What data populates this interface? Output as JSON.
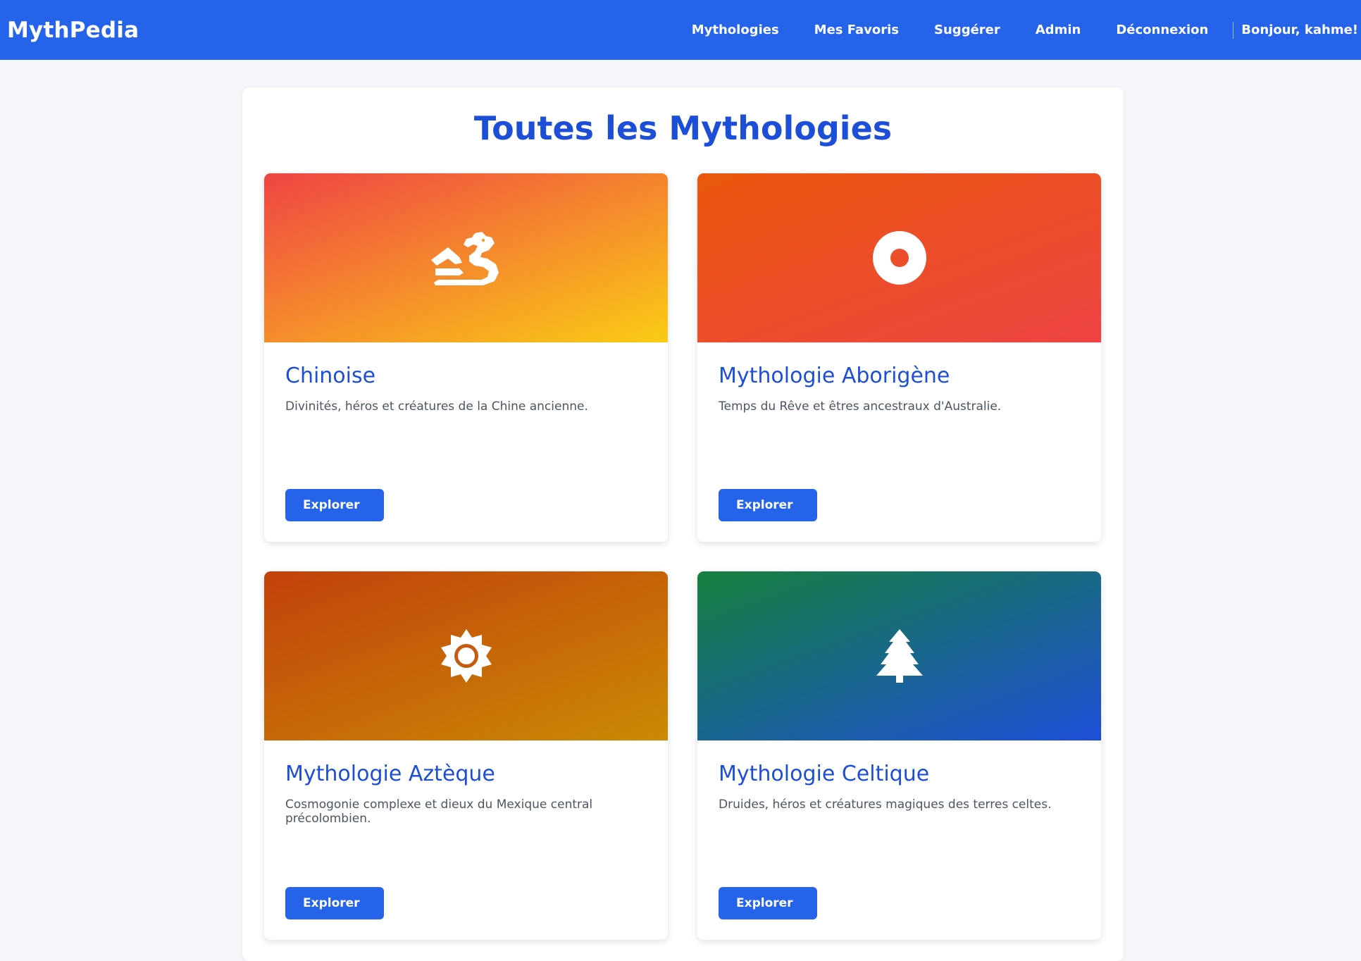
{
  "navbar": {
    "brand": "MythPedia",
    "links": [
      "Mythologies",
      "Mes Favoris",
      "Suggérer",
      "Admin",
      "Déconnexion"
    ],
    "greeting": "Bonjour, kahme!"
  },
  "main": {
    "title": "Toutes les Mythologies",
    "cards": [
      {
        "title": "Chinoise",
        "description": "Divinités, héros et créatures de la Chine ancienne.",
        "button": "Explorer",
        "icon": "dragon-icon",
        "gradient_from": "#ef4444",
        "gradient_to": "#facc15"
      },
      {
        "title": "Mythologie Aborigène",
        "description": "Temps du Rêve et êtres ancestraux d'Australie.",
        "button": "Explorer",
        "icon": "circle-dot-icon",
        "gradient_from": "#ea580c",
        "gradient_to": "#ef4444"
      },
      {
        "title": "Mythologie Aztèque",
        "description": "Cosmogonie complexe et dieux du Mexique central précolombien.",
        "button": "Explorer",
        "icon": "sun-icon",
        "gradient_from": "#c2410c",
        "gradient_to": "#ca8a04"
      },
      {
        "title": "Mythologie Celtique",
        "description": "Druides, héros et créatures magiques des terres celtes.",
        "button": "Explorer",
        "icon": "tree-icon",
        "gradient_from": "#15803d",
        "gradient_to": "#1d4ed8"
      }
    ]
  }
}
